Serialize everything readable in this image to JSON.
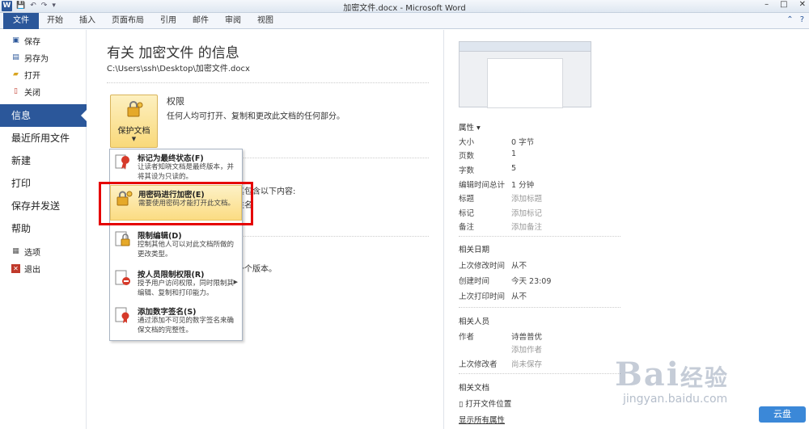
{
  "titlebar": {
    "app_icon": "W",
    "title": "加密文件.docx - Microsoft Word",
    "window_buttons": [
      "–",
      "□",
      "✕"
    ]
  },
  "ribbon": {
    "tabs": [
      "文件",
      "开始",
      "插入",
      "页面布局",
      "引用",
      "邮件",
      "审阅",
      "视图"
    ]
  },
  "sidebar": {
    "small_top": [
      {
        "label": "保存",
        "icon": "save-icon"
      },
      {
        "label": "另存为",
        "icon": "save-as-icon"
      },
      {
        "label": "打开",
        "icon": "open-folder-icon"
      },
      {
        "label": "关闭",
        "icon": "close-doc-icon"
      }
    ],
    "big": [
      "信息",
      "最近所用文件",
      "新建",
      "打印",
      "保存并发送",
      "帮助"
    ],
    "active": "信息",
    "small_bottom": [
      {
        "label": "选项",
        "icon": "options-icon"
      },
      {
        "label": "退出",
        "icon": "exit-icon"
      }
    ]
  },
  "info": {
    "title": "有关 加密文件 的信息",
    "path": "C:\\Users\\ssh\\Desktop\\加密文件.docx",
    "protect_button": "保护文档",
    "permissions_title": "权限",
    "permissions_desc": "任何人均可打开、复制和更改此文档的任何部分。",
    "peek_1": "其包含以下内容:",
    "peek_2": "姓名",
    "peek_3": "一个版本。"
  },
  "dropdown": {
    "items": [
      {
        "title": "标记为最终状态(F)",
        "desc": "让读者知晓文档是最终版本，并将其设为只读的。",
        "icon": "final-ribbon-icon"
      },
      {
        "title": "用密码进行加密(E)",
        "desc": "需要使用密码才能打开此文档。",
        "icon": "lock-key-icon"
      },
      {
        "title": "限制编辑(D)",
        "desc": "控制其他人可以对此文档所做的更改类型。",
        "icon": "restrict-edit-icon"
      },
      {
        "title": "按人员限制权限(R)",
        "desc": "授予用户访问权限，同时限制其编辑、复制和打印能力。",
        "icon": "restrict-permission-icon"
      },
      {
        "title": "添加数字签名(S)",
        "desc": "通过添加不可见的数字签名来确保文档的完整性。",
        "icon": "signature-icon"
      }
    ],
    "highlight_index": 1
  },
  "properties": {
    "header": "属性 ▾",
    "rows": [
      {
        "k": "大小",
        "v": "0 字节",
        "ph": false
      },
      {
        "k": "页数",
        "v": "1",
        "ph": false
      },
      {
        "k": "字数",
        "v": "5",
        "ph": false
      },
      {
        "k": "编辑时间总计",
        "v": "1 分钟",
        "ph": false
      },
      {
        "k": "标题",
        "v": "添加标题",
        "ph": true
      },
      {
        "k": "标记",
        "v": "添加标记",
        "ph": true
      },
      {
        "k": "备注",
        "v": "添加备注",
        "ph": true
      }
    ],
    "dates_header": "相关日期",
    "dates": [
      {
        "k": "上次修改时间",
        "v": "从不"
      },
      {
        "k": "创建时间",
        "v": "今天 23:09"
      },
      {
        "k": "上次打印时间",
        "v": "从不"
      }
    ],
    "people_header": "相关人员",
    "author_label": "作者",
    "author_value": "诗兽普优",
    "add_author": "添加作者",
    "last_modified_by_label": "上次修改者",
    "last_modified_by_value": "尚未保存",
    "docs_header": "相关文档",
    "open_location": "打开文件位置",
    "show_all": "显示所有属性"
  },
  "watermark": {
    "text": "Bai",
    "suffix": "经验",
    "url": "jingyan.baidu.com",
    "cloud": "云盘"
  }
}
